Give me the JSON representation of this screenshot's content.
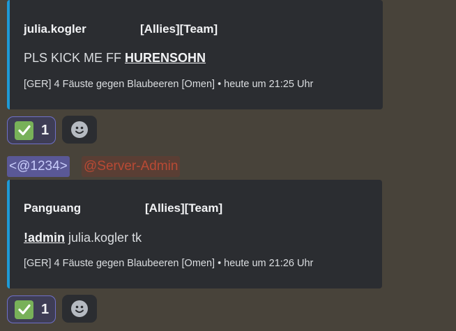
{
  "messages": [
    {
      "author": "julia.kogler",
      "team": "[Allies][Team]",
      "text_plain": "PLS KICK ME FF ",
      "text_bold": "HURENSOHN",
      "footer": "[GER] 4 Fäuste gegen Blaubeeren  [Omen] • heute um 21:25 Uhr",
      "reaction": {
        "emoji": "check-mark-icon",
        "count": "1"
      }
    },
    {
      "author": "Panguang",
      "team": "[Allies][Team]",
      "text_bold": "!admin",
      "text_plain": " julia.kogler tk",
      "footer": "[GER] 4 Fäuste gegen Blaubeeren  [Omen] • heute um 21:26 Uhr",
      "reaction": {
        "emoji": "check-mark-icon",
        "count": "1"
      }
    }
  ],
  "mentions": {
    "raw_id": "<@1234>",
    "role": "@Server-Admin"
  },
  "colors": {
    "background": "#48433a",
    "embed": "#2b2d31",
    "embed_border": "#1e9ad6",
    "reaction_bg": "#3e3d55",
    "reaction_border": "#6f70c9",
    "role_mention": "#b94a34",
    "user_mention_bg": "#5a5896"
  }
}
